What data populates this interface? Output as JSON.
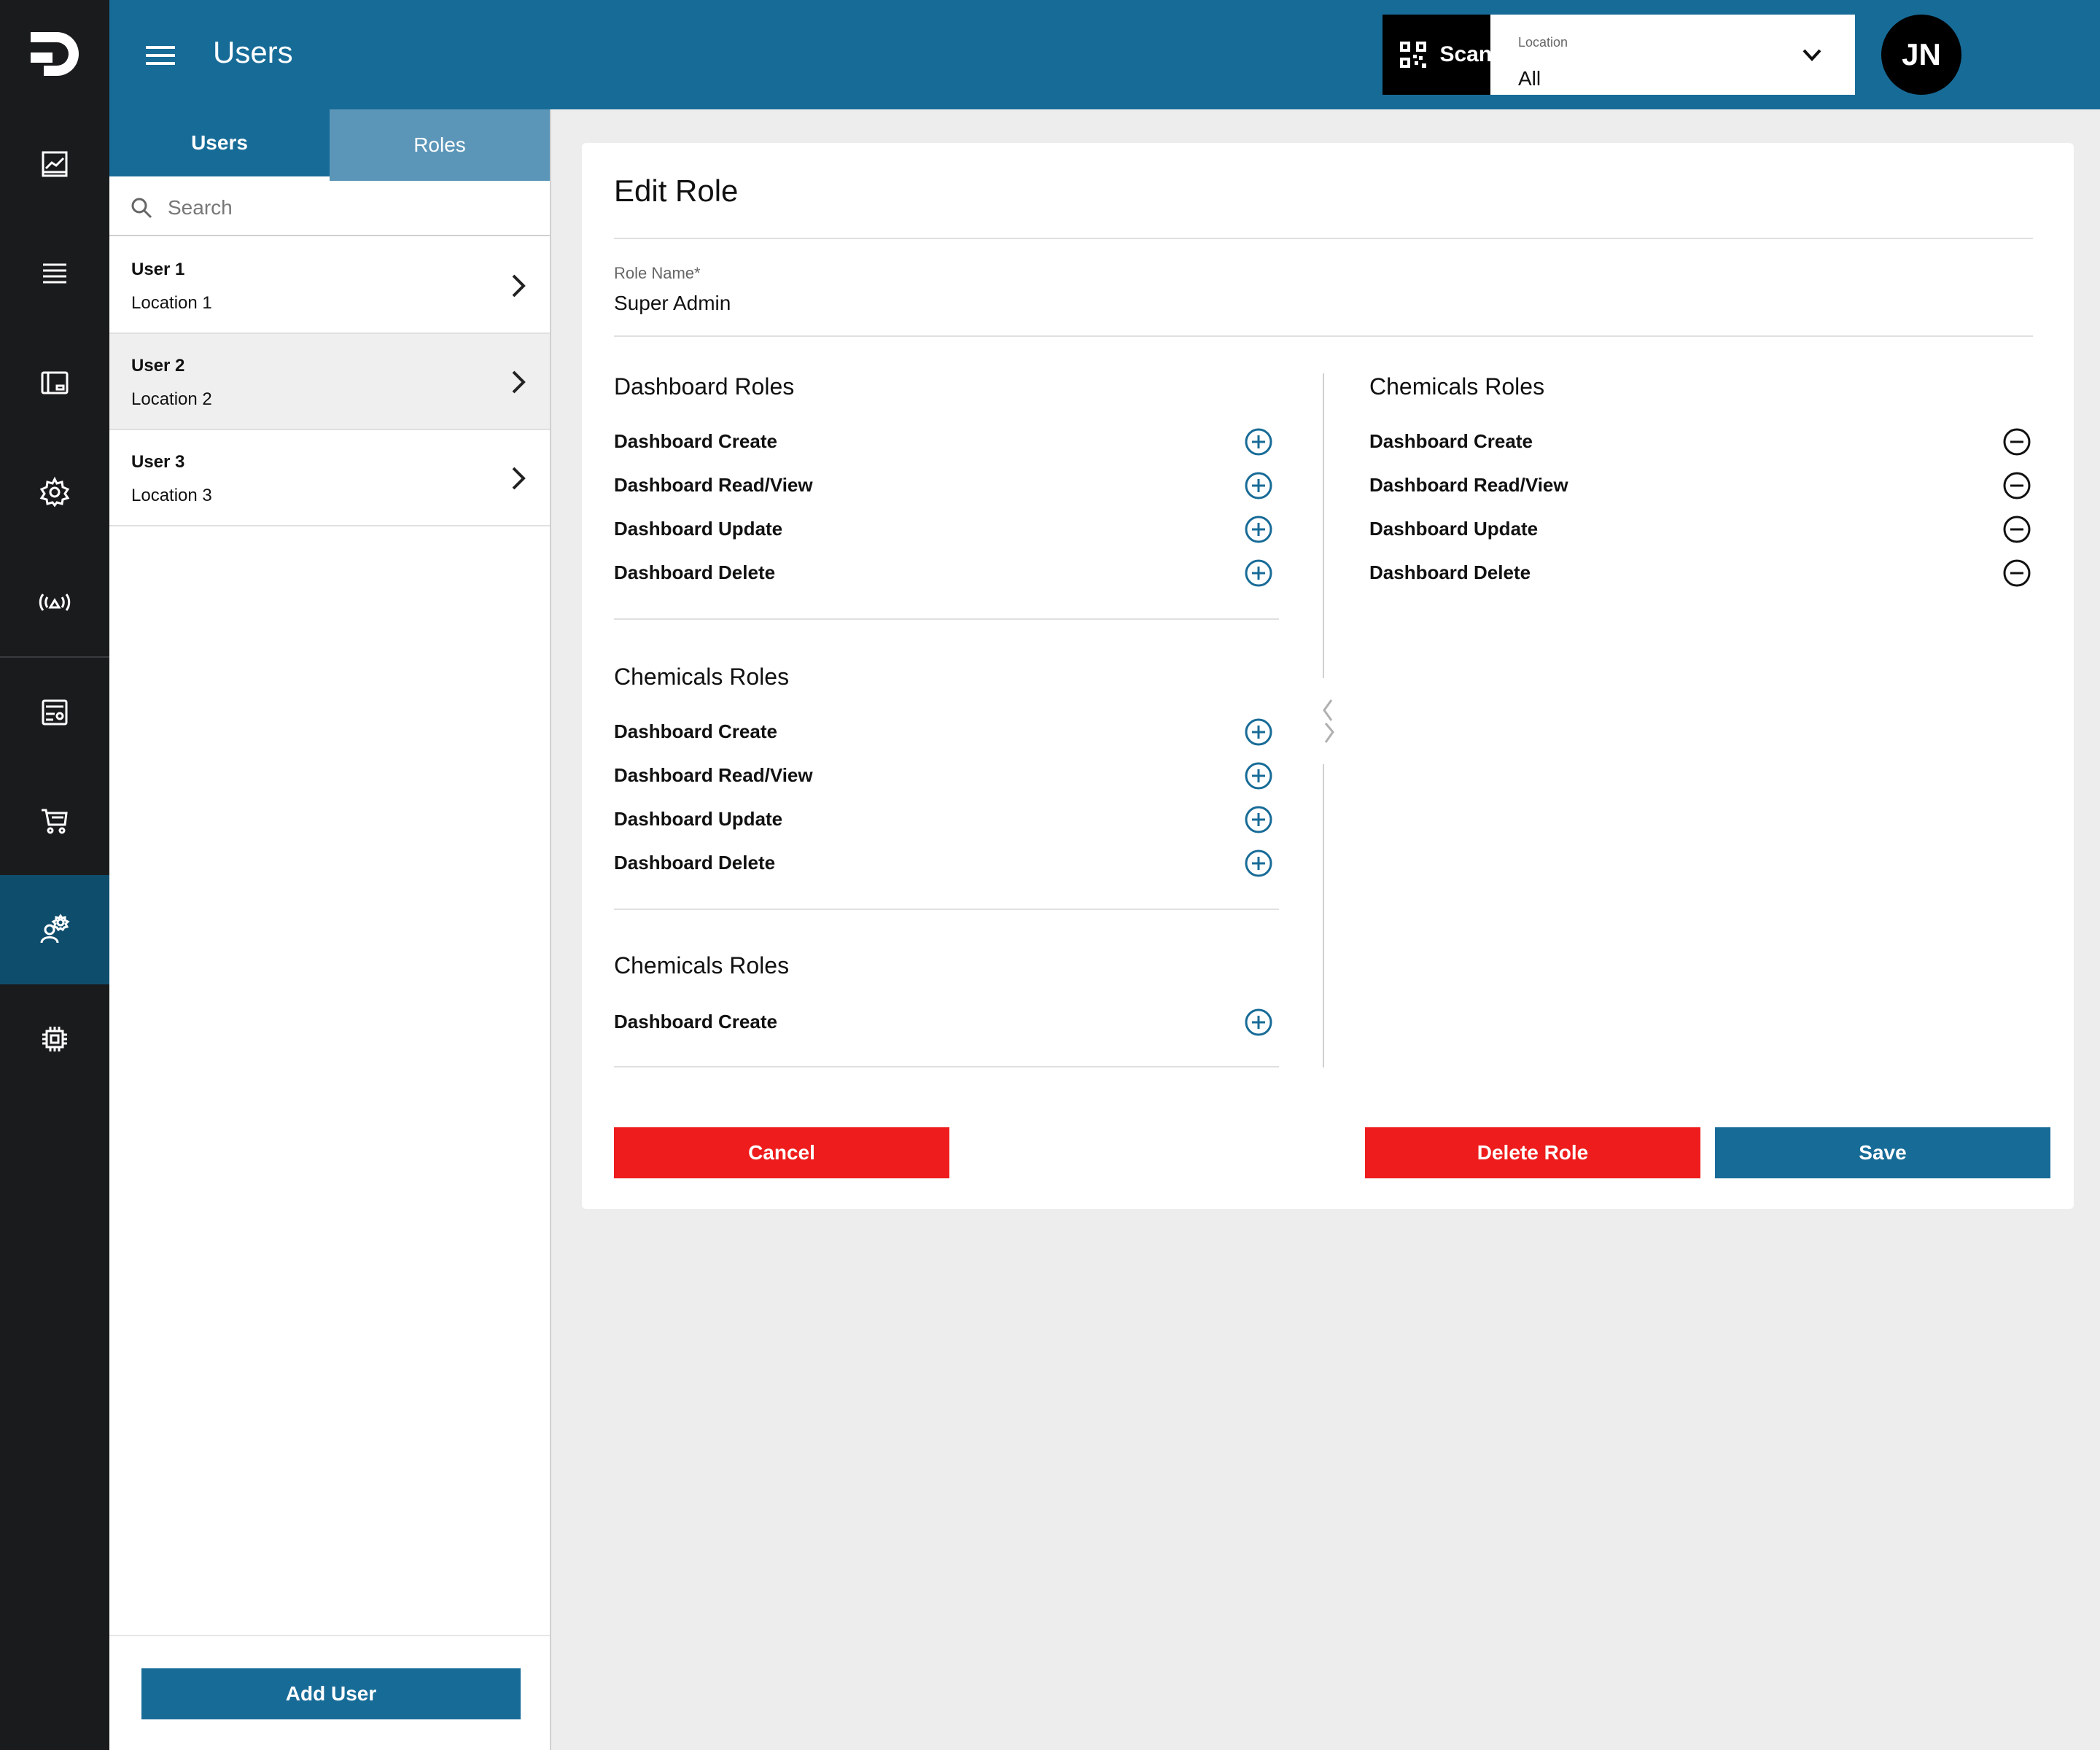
{
  "header": {
    "title": "Users",
    "scan_label": "Scan Code",
    "location_label": "Location",
    "location_value": "All",
    "avatar_initials": "JN"
  },
  "rail": {
    "items": [
      "logo-icon",
      "chart-icon",
      "list-icon",
      "dashboard-icon",
      "settings-gear-icon",
      "broadcast-icon",
      "report-icon",
      "cart-icon",
      "user-settings-icon",
      "chip-icon"
    ],
    "active": "user-settings-icon"
  },
  "left_panel": {
    "tabs": [
      {
        "label": "Users",
        "active": true
      },
      {
        "label": "Roles",
        "active": false
      }
    ],
    "search_placeholder": "Search",
    "users": [
      {
        "name": "User 1",
        "location": "Location 1"
      },
      {
        "name": "User 2",
        "location": "Location 2",
        "selected": true
      },
      {
        "name": "User 3",
        "location": "Location 3"
      }
    ],
    "add_user_label": "Add User"
  },
  "edit_role": {
    "title": "Edit Role",
    "role_name_label": "Role Name*",
    "role_name_value": "Super Admin",
    "available_sections": [
      {
        "title": "Dashboard Roles",
        "items": [
          "Dashboard Create",
          "Dashboard Read/View",
          "Dashboard Update",
          "Dashboard Delete"
        ]
      },
      {
        "title": "Chemicals Roles",
        "items": [
          "Dashboard Create",
          "Dashboard Read/View",
          "Dashboard Update",
          "Dashboard Delete"
        ]
      },
      {
        "title": "Chemicals Roles",
        "items": [
          "Dashboard Create"
        ]
      }
    ],
    "assigned_sections": [
      {
        "title": "Chemicals Roles",
        "items": [
          "Dashboard Create",
          "Dashboard Read/View",
          "Dashboard Update",
          "Dashboard Delete"
        ]
      }
    ],
    "cancel_label": "Cancel",
    "delete_label": "Delete Role",
    "save_label": "Save"
  },
  "colors": {
    "primary": "#176b97",
    "danger": "#ee1c1c",
    "rail": "#1a1b1d",
    "active_rail": "#0f4d6d"
  }
}
